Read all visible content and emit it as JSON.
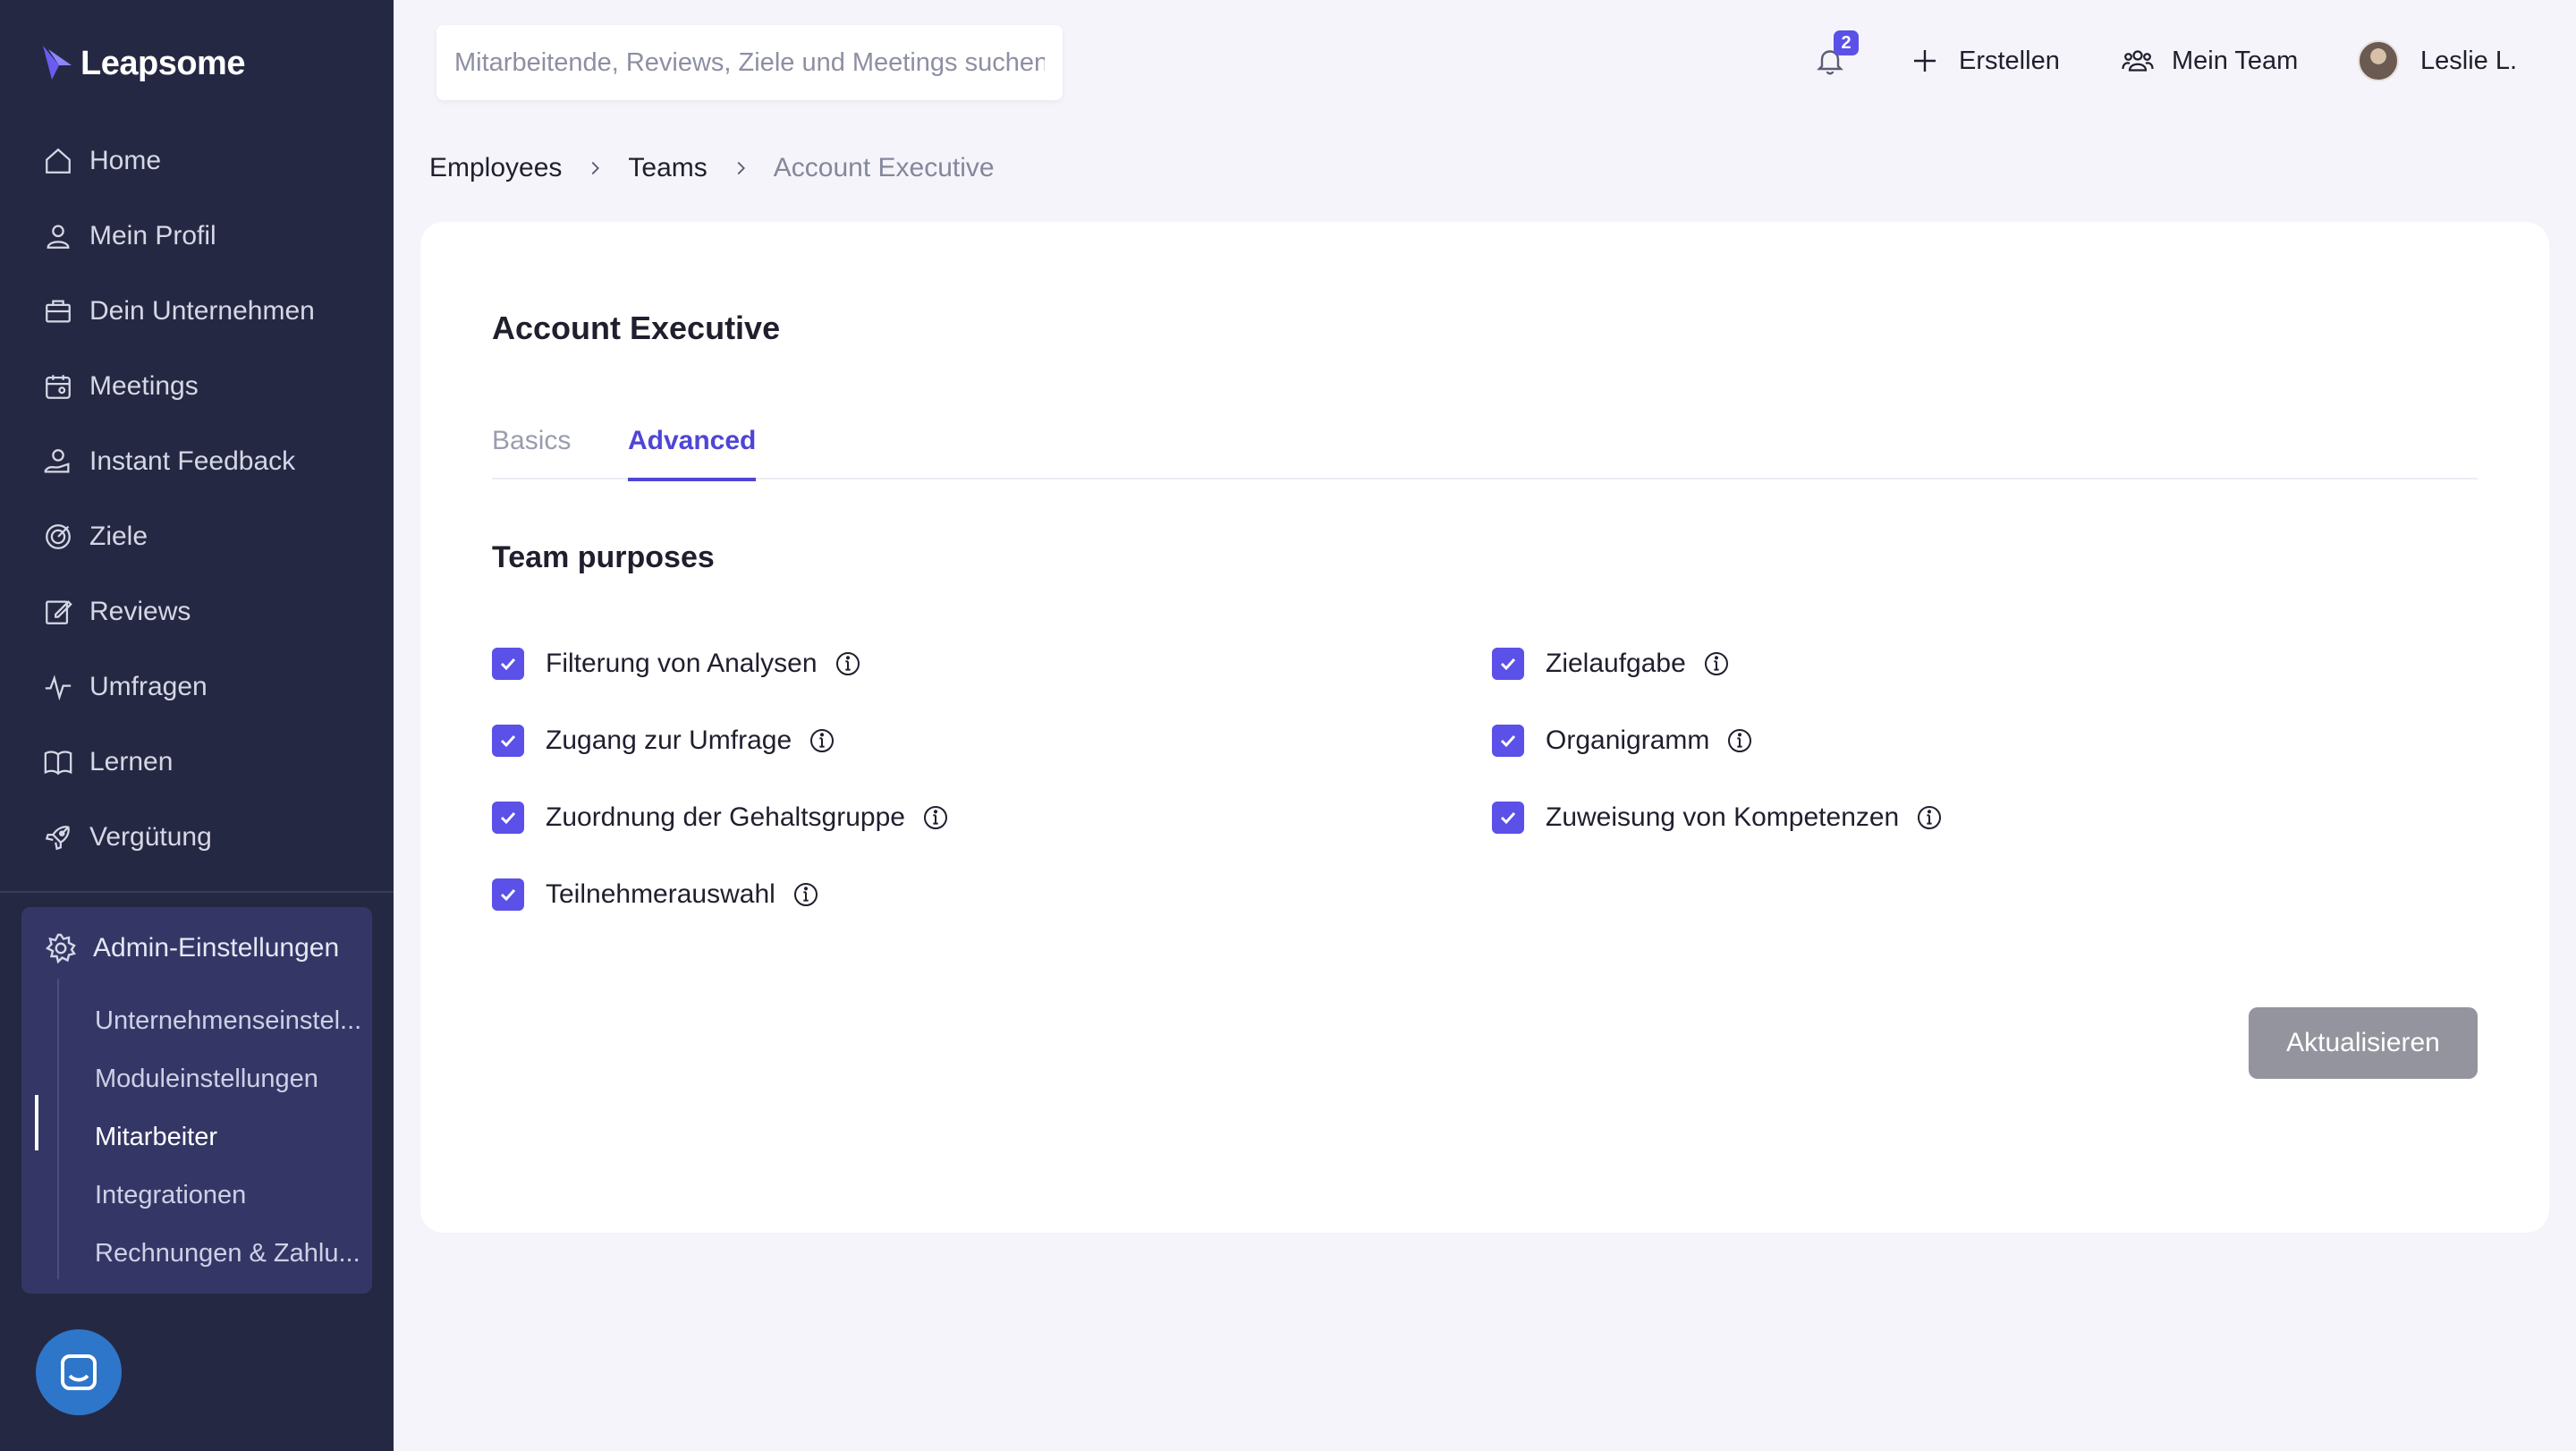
{
  "app": {
    "logo": "Leapsome"
  },
  "sidebar": {
    "items": [
      {
        "label": "Home",
        "icon": "home-icon"
      },
      {
        "label": "Mein Profil",
        "icon": "user-icon"
      },
      {
        "label": "Dein Unternehmen",
        "icon": "briefcase-icon"
      },
      {
        "label": "Meetings",
        "icon": "calendar-icon"
      },
      {
        "label": "Instant Feedback",
        "icon": "feedback-icon"
      },
      {
        "label": "Ziele",
        "icon": "target-icon"
      },
      {
        "label": "Reviews",
        "icon": "edit-icon"
      },
      {
        "label": "Umfragen",
        "icon": "pulse-icon"
      },
      {
        "label": "Lernen",
        "icon": "book-icon"
      },
      {
        "label": "Vergütung",
        "icon": "rocket-icon"
      }
    ],
    "admin": {
      "label": "Admin-Einstellungen",
      "subitems": [
        {
          "label": "Unternehmenseinstel..."
        },
        {
          "label": "Moduleinstellungen"
        },
        {
          "label": "Mitarbeiter",
          "active": true
        },
        {
          "label": "Integrationen"
        },
        {
          "label": "Rechnungen & Zahlu..."
        }
      ]
    }
  },
  "topbar": {
    "search_placeholder": "Mitarbeitende, Reviews, Ziele und Meetings suchen",
    "notification_count": "2",
    "create_label": "Erstellen",
    "team_label": "Mein Team",
    "user_name": "Leslie L."
  },
  "breadcrumb": [
    "Employees",
    "Teams",
    "Account Executive"
  ],
  "card": {
    "title": "Account Executive",
    "tabs": [
      {
        "label": "Basics",
        "active": false
      },
      {
        "label": "Advanced",
        "active": true
      }
    ],
    "section_title": "Team purposes",
    "purposes_left": [
      {
        "label": "Filterung von Analysen",
        "checked": true
      },
      {
        "label": "Zugang zur Umfrage",
        "checked": true
      },
      {
        "label": "Zuordnung der Gehaltsgruppe",
        "checked": true
      },
      {
        "label": "Teilnehmerauswahl",
        "checked": true
      }
    ],
    "purposes_right": [
      {
        "label": "Zielaufgabe",
        "checked": true
      },
      {
        "label": "Organigramm",
        "checked": true
      },
      {
        "label": "Zuweisung von Kompetenzen",
        "checked": true
      }
    ],
    "submit_label": "Aktualisieren"
  },
  "colors": {
    "sidebar_bg": "#252842",
    "admin_box_bg": "#343766",
    "accent": "#5b50e8",
    "page_bg": "#f4f4fa",
    "button_disabled": "#94949e"
  }
}
